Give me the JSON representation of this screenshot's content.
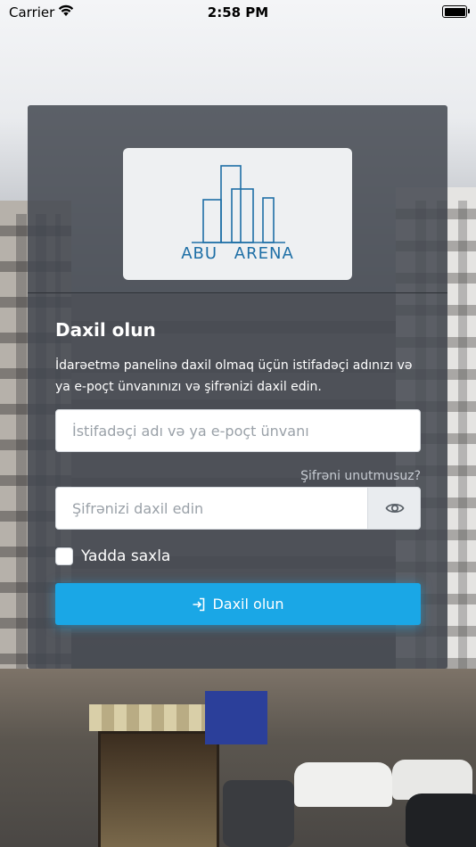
{
  "status_bar": {
    "carrier": "Carrier",
    "time": "2:58 PM"
  },
  "login": {
    "logo_text": "ABU ARENA",
    "title": "Daxil olun",
    "description": "İdarəetmə panelinə daxil olmaq üçün istifadəçi adınızı və ya e-poçt ünvanınızı və şifrənizi daxil edin.",
    "username_placeholder": "İstifadəçi adı və ya e-poçt ünvanı",
    "forgot_password": "Şifrəni unutmusuz?",
    "password_placeholder": "Şifrənizi daxil edin",
    "remember_me": "Yadda saxla",
    "submit_label": "Daxil olun"
  },
  "colors": {
    "accent": "#1aa7e6",
    "logo": "#1e6fa6",
    "card_bg": "#444850"
  },
  "icons": {
    "wifi": "wifi-icon",
    "battery": "battery-icon",
    "eye": "eye-icon",
    "sign_in": "sign-in-icon",
    "logo": "buildings-logo-icon"
  }
}
